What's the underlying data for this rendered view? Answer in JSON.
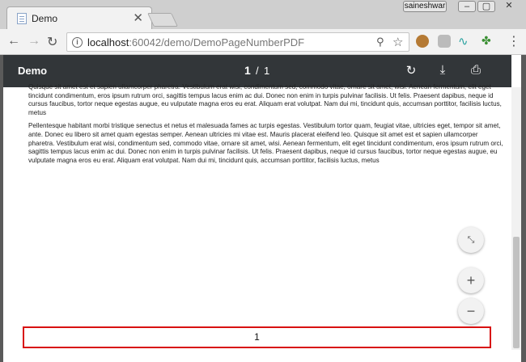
{
  "browser": {
    "tab_title": "Demo",
    "tab_close": "✕",
    "profile_name": "saineshwar",
    "url_host": "localhost",
    "url_rest": ":60042/demo/DemoPageNumberPDF"
  },
  "pdf_viewer": {
    "title": "Demo",
    "current_page": "1",
    "page_separator": "/",
    "total_pages": "1"
  },
  "document": {
    "paragraphs": [
      "Quisque sit amet est et sapien ullamcorper pharetra. Vestibulum erat wisi, condimentum sed, commodo vitae, ornare sit amet, wisi. Aenean fermentum, elit eget tincidunt condimentum, eros ipsum rutrum orci, sagittis tempus lacus enim ac dui. Donec non enim in turpis pulvinar facilisis. Ut felis. Praesent dapibus, neque id cursus faucibus, tortor neque egestas augue, eu vulputate magna eros eu erat. Aliquam erat volutpat. Nam dui mi, tincidunt quis, accumsan porttitor, facilisis luctus, metus",
      "Pellentesque habitant morbi tristique senectus et netus et malesuada fames ac turpis egestas. Vestibulum tortor quam, feugiat vitae, ultricies eget, tempor sit amet, ante. Donec eu libero sit amet quam egestas semper. Aenean ultricies mi vitae est. Mauris placerat eleifend leo. Quisque sit amet est et sapien ullamcorper pharetra. Vestibulum erat wisi, condimentum sed, commodo vitae, ornare sit amet, wisi. Aenean fermentum, elit eget tincidunt condimentum, eros ipsum rutrum orci, sagittis tempus lacus enim ac dui. Donec non enim in turpis pulvinar facilisis. Ut felis. Praesent dapibus, neque id cursus faucibus, tortor neque egestas augue, eu vulputate magna eros eu erat. Aliquam erat volutpat. Nam dui mi, tincidunt quis, accumsan porttitor, facilisis luctus, metus"
    ],
    "footer_page_number": "1"
  },
  "icons": {
    "back": "back-arrow-icon",
    "forward": "forward-arrow-icon",
    "reload": "reload-icon",
    "info": "info-icon",
    "zoom": "zoom-icon",
    "star": "star-icon",
    "rotate": "rotate-icon",
    "download": "download-icon",
    "print": "print-icon",
    "fit": "fit-to-page-icon",
    "zoom_in": "plus-icon",
    "zoom_out": "minus-icon"
  },
  "colors": {
    "pdf_toolbar": "#323639",
    "footer_border": "#d81010"
  }
}
